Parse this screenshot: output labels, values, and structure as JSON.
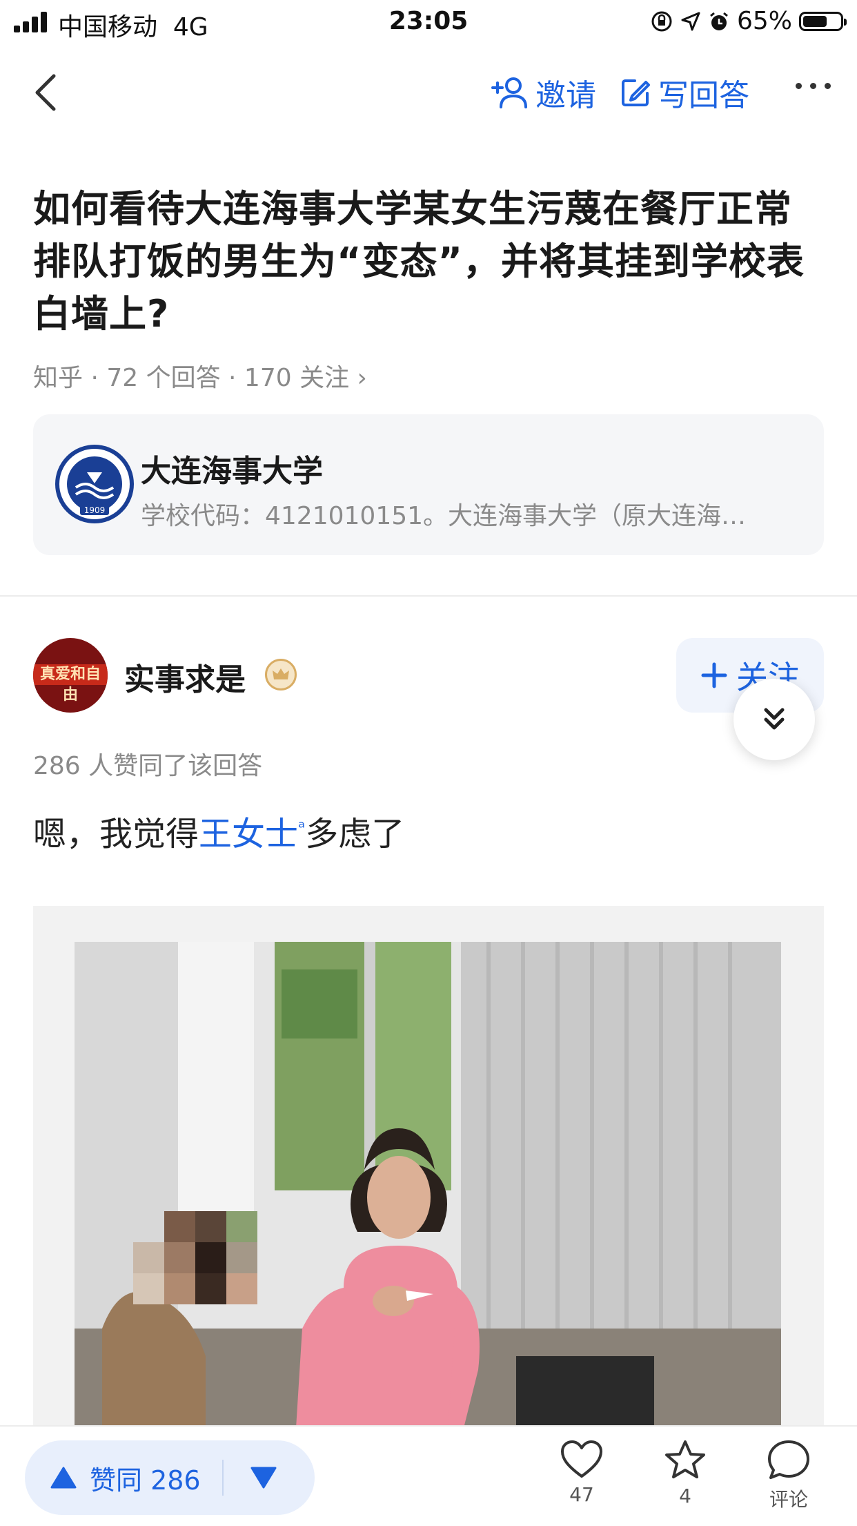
{
  "status_bar": {
    "carrier": "中国移动",
    "network": "4G",
    "time": "23:05",
    "battery": "65%",
    "battery_level": 0.65
  },
  "nav": {
    "invite_label": "邀请",
    "write_answer_label": "写回答"
  },
  "question": {
    "title": "如何看待大连海事大学某女生污蔑在餐厅正常排队打饭的男生为“变态”，并将其挂到学校表白墙上?",
    "meta": "知乎 · 72 个回答 · 170 关注 ›"
  },
  "topic": {
    "name": "大连海事大学",
    "description": "学校代码：4121010151。大连海事大学（原大连海…",
    "logo_year": "1909"
  },
  "answer": {
    "author": "实事求是",
    "avatar_text": "真爱和自由",
    "follow_label": "关注",
    "votes_text": "286 人赞同了该回答",
    "text_before": "嗯，我觉得",
    "link_text": "王女士",
    "text_after": "多虑了"
  },
  "bottom_bar": {
    "upvote_label": "赞同 286",
    "likes_count": "47",
    "favorites_count": "4",
    "comments_label": "评论"
  },
  "colors": {
    "accent": "#1d63e0",
    "muted": "#8a8a8a",
    "card_bg": "#f5f6f8"
  },
  "icons": [
    "back-icon",
    "invite-icon",
    "edit-icon",
    "more-icon",
    "chevron-double-down-icon",
    "crown-badge-icon",
    "triangle-up-icon",
    "triangle-down-icon",
    "heart-icon",
    "star-icon",
    "comment-icon"
  ]
}
